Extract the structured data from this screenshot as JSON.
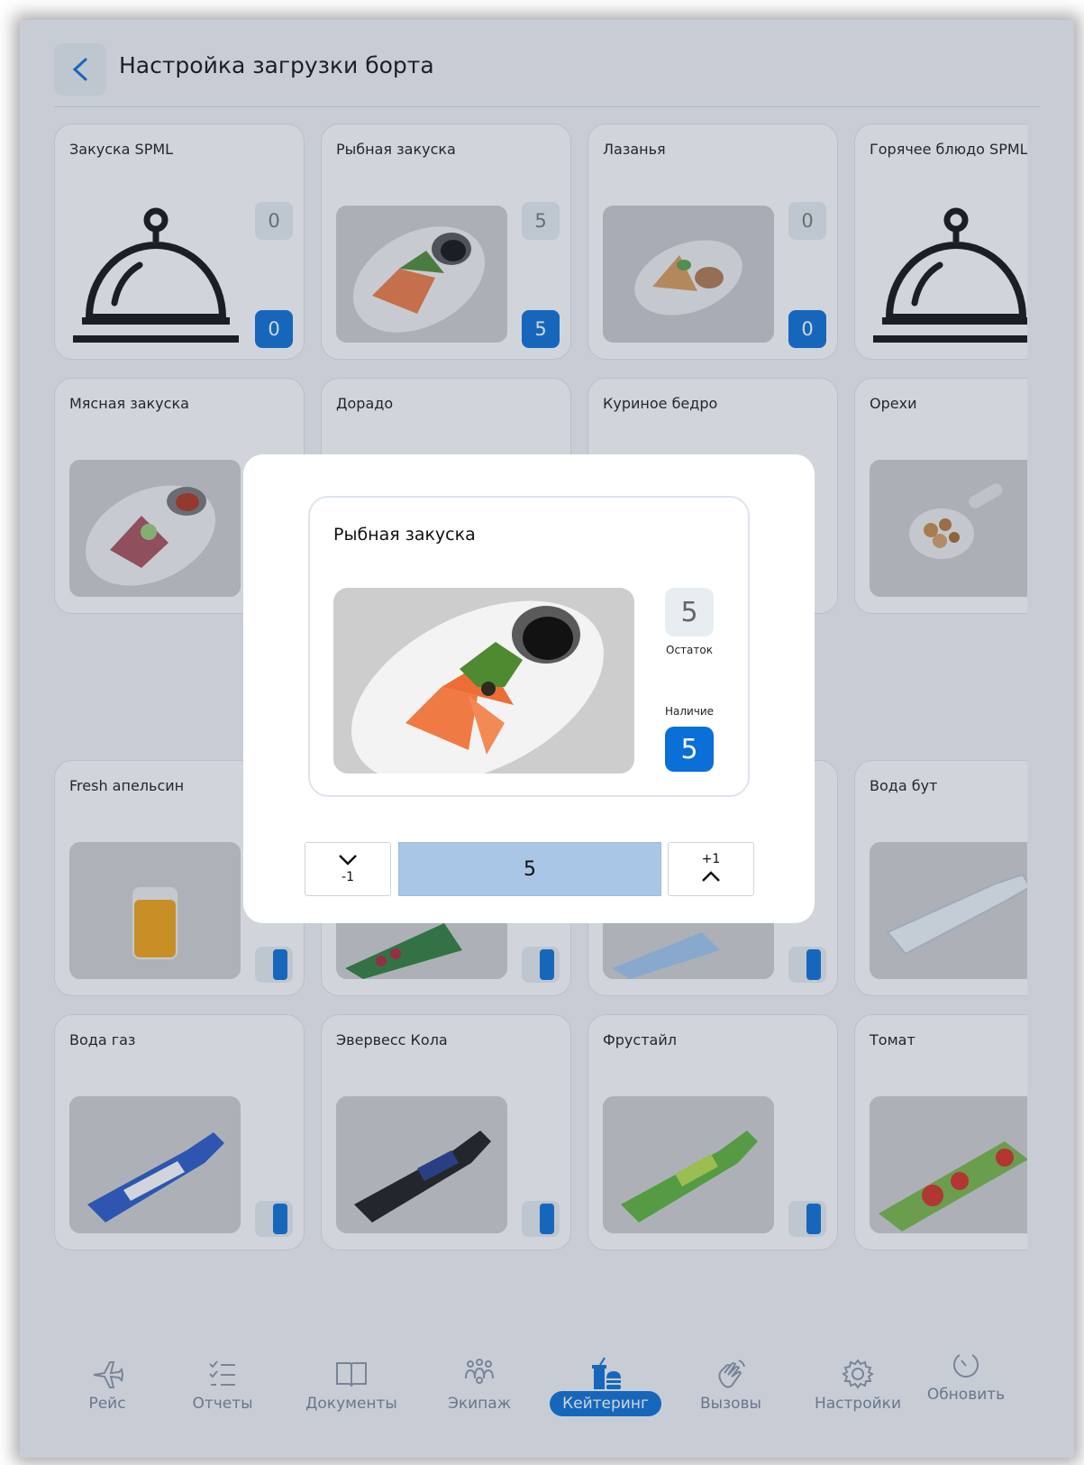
{
  "header": {
    "back_icon": "chevron-left-icon",
    "title": "Настройка загрузки борта"
  },
  "products": [
    {
      "title": "Закуска SPML",
      "image": "cloche-icon",
      "remaining": "0",
      "loaded": "0"
    },
    {
      "title": "Рыбная закуска",
      "image": "fish-appetizer-photo",
      "remaining": "5",
      "loaded": "5"
    },
    {
      "title": "Лазанья",
      "image": "lasagna-photo",
      "remaining": "0",
      "loaded": "0"
    },
    {
      "title": "Горячее блюдо SPML",
      "image": "cloche-icon"
    },
    {
      "title": "Мясная закуска",
      "image": "meat-appetizer-photo"
    },
    {
      "title": "Дорадо"
    },
    {
      "title": "Куриное бедро"
    },
    {
      "title": "Орехи",
      "image": "nuts-photo"
    },
    {
      "title": "Fresh апельсин",
      "image": "orange-juice-photo"
    },
    {
      "title": "",
      "image": "juice-pack-photo"
    },
    {
      "title": "",
      "image": "water-bottle-photo"
    },
    {
      "title": "Вода бут",
      "image": "water-bottle-photo"
    },
    {
      "title": "Вода газ",
      "image": "water-bottle-photo"
    },
    {
      "title": "Эвервесс Кола",
      "image": "cola-bottle-photo"
    },
    {
      "title": "Фрустайл",
      "image": "lemonade-bottle-photo"
    },
    {
      "title": "Томат",
      "image": "tomato-juice-photo"
    }
  ],
  "modal": {
    "title": "Рыбная закуска",
    "remaining_value": "5",
    "remaining_label": "Остаток",
    "available_label": "Наличие",
    "available_value": "5",
    "decrement_label": "-1",
    "increment_label": "+1",
    "quantity": "5"
  },
  "nav": [
    {
      "label": "Рейс",
      "icon": "airplane-icon",
      "active": false
    },
    {
      "label": "Отчеты",
      "icon": "checklist-icon",
      "active": false
    },
    {
      "label": "Документы",
      "icon": "book-icon",
      "active": false
    },
    {
      "label": "Экипаж",
      "icon": "crew-icon",
      "active": false
    },
    {
      "label": "Кейтеринг",
      "icon": "catering-icon",
      "active": true
    },
    {
      "label": "Вызовы",
      "icon": "hand-wave-icon",
      "active": false
    },
    {
      "label": "Настройки",
      "icon": "gear-icon",
      "active": false
    },
    {
      "label": "Обновить",
      "icon": "refresh-timer-icon",
      "active": false
    }
  ],
  "colors": {
    "accent": "#0a6fd6",
    "background": "#f4f5f7",
    "quantity_field": "#a9c6e6"
  }
}
